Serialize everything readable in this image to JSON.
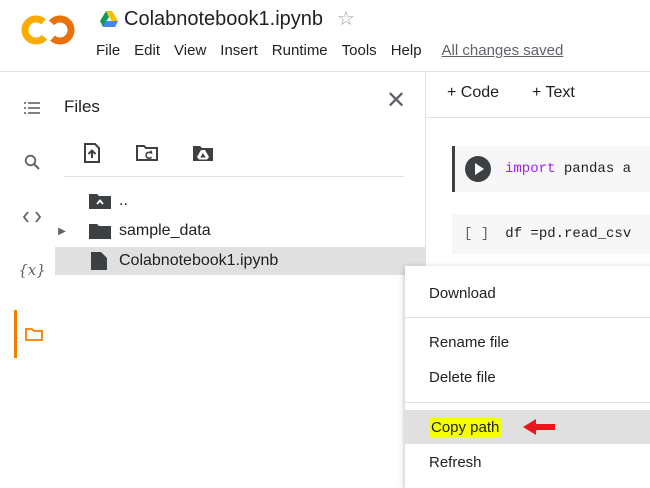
{
  "header": {
    "logo_text": "CO",
    "title": "Colabnotebook1.ipynb",
    "menu": [
      "File",
      "Edit",
      "View",
      "Insert",
      "Runtime",
      "Tools",
      "Help"
    ],
    "saved_status": "All changes saved"
  },
  "rail": {
    "icons": [
      "toc-icon",
      "search-icon",
      "code-snippets-icon",
      "variables-icon",
      "folder-icon"
    ],
    "variables_label": "{x}"
  },
  "files": {
    "title": "Files",
    "tree": [
      {
        "label": "..",
        "type": "parent"
      },
      {
        "label": "sample_data",
        "type": "folder"
      },
      {
        "label": "Colabnotebook1.ipynb",
        "type": "file"
      }
    ]
  },
  "notebook": {
    "add_code": "+ Code",
    "add_text": "+ Text",
    "cell1_keyword": "import",
    "cell1_rest": " pandas a",
    "cell2_prompt": "[ ]",
    "cell2_code": "df =pd.read_csv"
  },
  "context_menu": {
    "items": [
      "Download",
      "Rename file",
      "Delete file",
      "Copy path",
      "Refresh"
    ]
  },
  "colors": {
    "accent_orange": "#f57c00",
    "highlight_yellow": "#f4ff00",
    "arrow_red": "#e8161b"
  }
}
